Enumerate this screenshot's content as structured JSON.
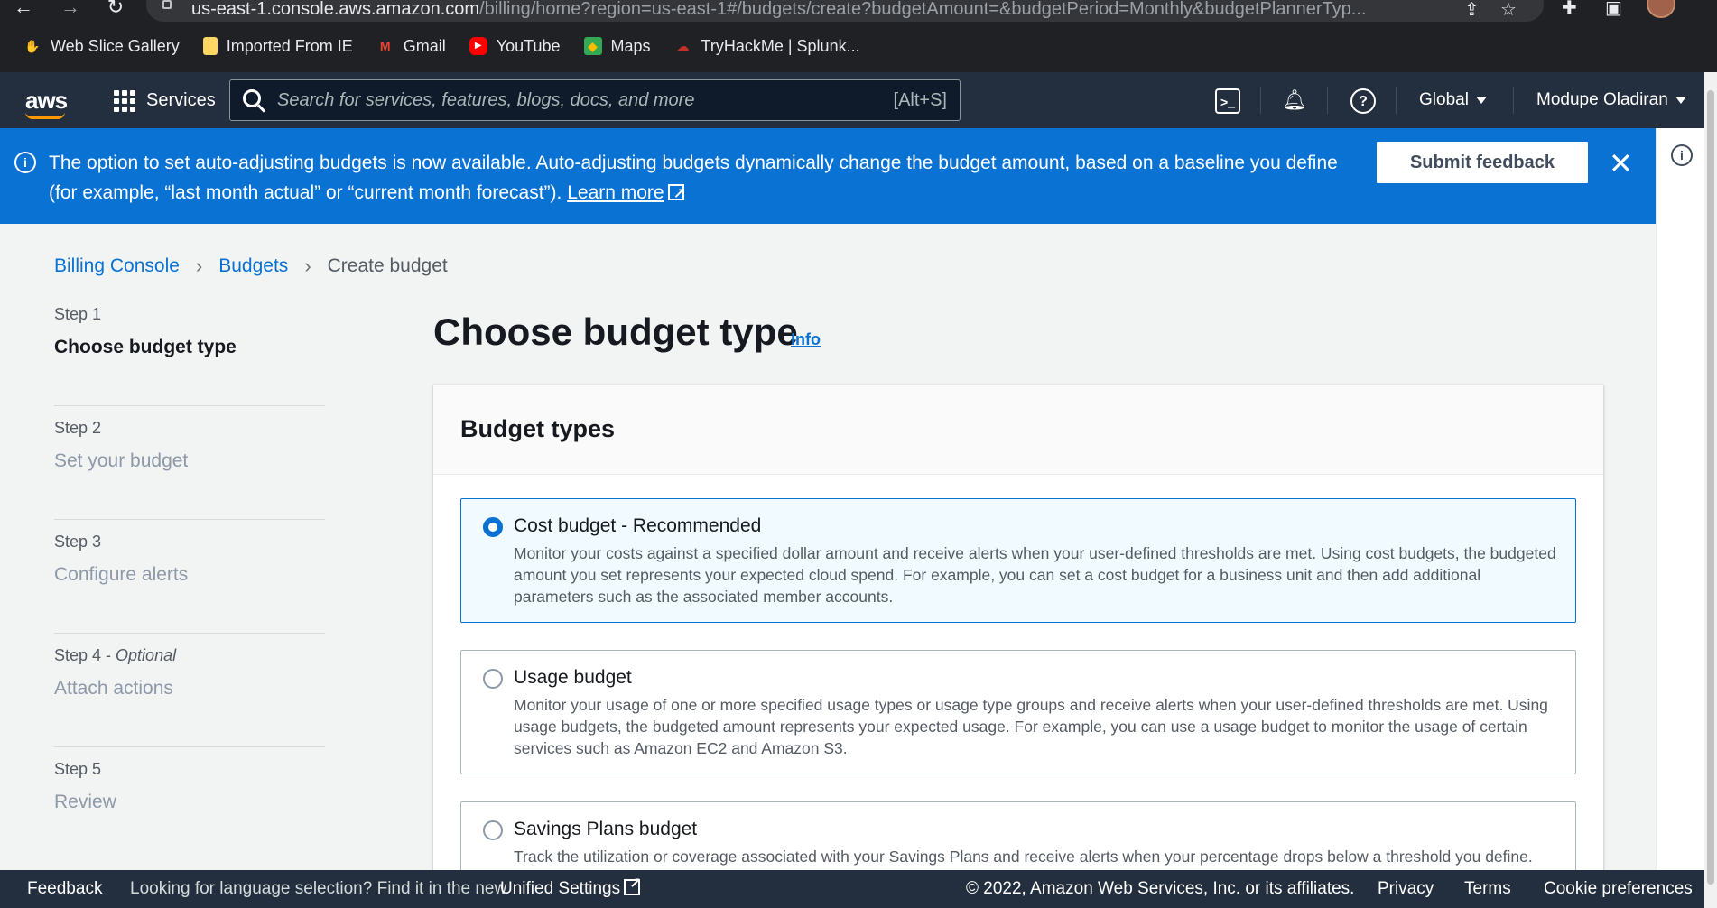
{
  "browser": {
    "url_host": "us-east-1.console.aws.amazon.com",
    "url_path": "/billing/home?region=us-east-1#/budgets/create?budgetAmount=&budgetPeriod=Monthly&budgetPlannerTyp...",
    "bookmarks": [
      {
        "label": "Web Slice Gallery",
        "icon": "web-slice-icon"
      },
      {
        "label": "Imported From IE",
        "icon": "folder-icon"
      },
      {
        "label": "Gmail",
        "icon": "gmail-icon"
      },
      {
        "label": "YouTube",
        "icon": "youtube-icon"
      },
      {
        "label": "Maps",
        "icon": "maps-icon"
      },
      {
        "label": "TryHackMe | Splunk...",
        "icon": "tryhackme-icon"
      }
    ]
  },
  "aws_nav": {
    "logo": "aws",
    "services_label": "Services",
    "search_placeholder": "Search for services, features, blogs, docs, and more",
    "search_shortcut": "[Alt+S]",
    "region": "Global",
    "user": "Modupe Oladiran"
  },
  "banner": {
    "message": "The option to set auto-adjusting budgets is now available. Auto-adjusting budgets dynamically change the budget amount, based on a baseline you define (for example, “last month actual” or “current month forecast”).",
    "link": "Learn more",
    "button": "Submit feedback"
  },
  "breadcrumb": {
    "items": [
      "Billing Console",
      "Budgets"
    ],
    "current": "Create budget"
  },
  "steps": [
    {
      "num": "Step 1",
      "optional": "",
      "name": "Choose budget type",
      "active": true
    },
    {
      "num": "Step 2",
      "optional": "",
      "name": "Set your budget",
      "active": false
    },
    {
      "num": "Step 3",
      "optional": "",
      "name": "Configure alerts",
      "active": false
    },
    {
      "num": "Step 4 - ",
      "optional": "Optional",
      "name": "Attach actions",
      "active": false
    },
    {
      "num": "Step 5",
      "optional": "",
      "name": "Review",
      "active": false
    }
  ],
  "page": {
    "title": "Choose budget type",
    "info": "Info",
    "section_title": "Budget types"
  },
  "budget_types": [
    {
      "title": "Cost budget - Recommended",
      "selected": true,
      "desc": "Monitor your costs against a specified dollar amount and receive alerts when your user-defined thresholds are met. Using cost budgets, the budgeted amount you set represents your expected cloud spend. For example, you can set a cost budget for a business unit and then add additional parameters such as the associated member accounts."
    },
    {
      "title": "Usage budget",
      "selected": false,
      "desc": "Monitor your usage of one or more specified usage types or usage type groups and receive alerts when your user-defined thresholds are met. Using usage budgets, the budgeted amount represents your expected usage. For example, you can use a usage budget to monitor the usage of certain services such as Amazon EC2 and Amazon S3."
    },
    {
      "title": "Savings Plans budget",
      "selected": false,
      "desc": "Track the utilization or coverage associated with your Savings Plans and receive alerts when your percentage drops below a threshold you define."
    }
  ],
  "footer": {
    "feedback": "Feedback",
    "language_text": "Looking for language selection? Find it in the new",
    "unified_settings": "Unified Settings",
    "copyright": "© 2022, Amazon Web Services, Inc. or its affiliates.",
    "privacy": "Privacy",
    "terms": "Terms",
    "cookies": "Cookie preferences"
  },
  "colors": {
    "aws_nav": "#232f3e",
    "banner": "#0972d3",
    "link": "#0972d3",
    "aws_orange": "#ff9900"
  }
}
